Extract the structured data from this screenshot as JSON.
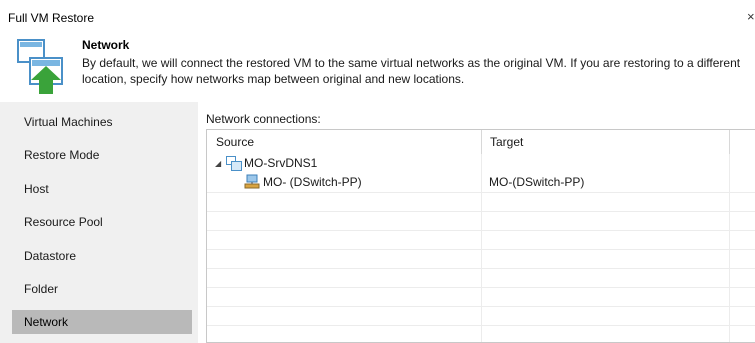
{
  "window": {
    "title": "Full VM Restore",
    "close_glyph": "×"
  },
  "header": {
    "icon": "network-restore-icon",
    "title": "Network",
    "description": "By default, we will connect the restored VM to the same virtual networks as the original VM. If you are restoring to a different location, specify how networks map between original and new locations."
  },
  "sidebar": {
    "items": [
      {
        "label": "Virtual Machines",
        "active": false
      },
      {
        "label": "Restore Mode",
        "active": false
      },
      {
        "label": "Host",
        "active": false
      },
      {
        "label": "Resource Pool",
        "active": false
      },
      {
        "label": "Datastore",
        "active": false
      },
      {
        "label": "Folder",
        "active": false
      },
      {
        "label": "Network",
        "active": true
      }
    ]
  },
  "network": {
    "section_label": "Network connections:",
    "columns": {
      "source": "Source",
      "target": "Target"
    },
    "rows": [
      {
        "level": 0,
        "expanded": true,
        "icon": "vm-icon",
        "source": "MO-SrvDNS1",
        "target": ""
      },
      {
        "level": 1,
        "icon": "network-adapter-icon",
        "source": "MO- (DSwitch-PP)",
        "target": "MO-(DSwitch-PP)"
      }
    ]
  },
  "colors": {
    "sidebar_bg": "#f0f0f0",
    "active_item_bg": "#b9b9b9",
    "icon_blue": "#4a90c8",
    "icon_green": "#3aa33a"
  }
}
